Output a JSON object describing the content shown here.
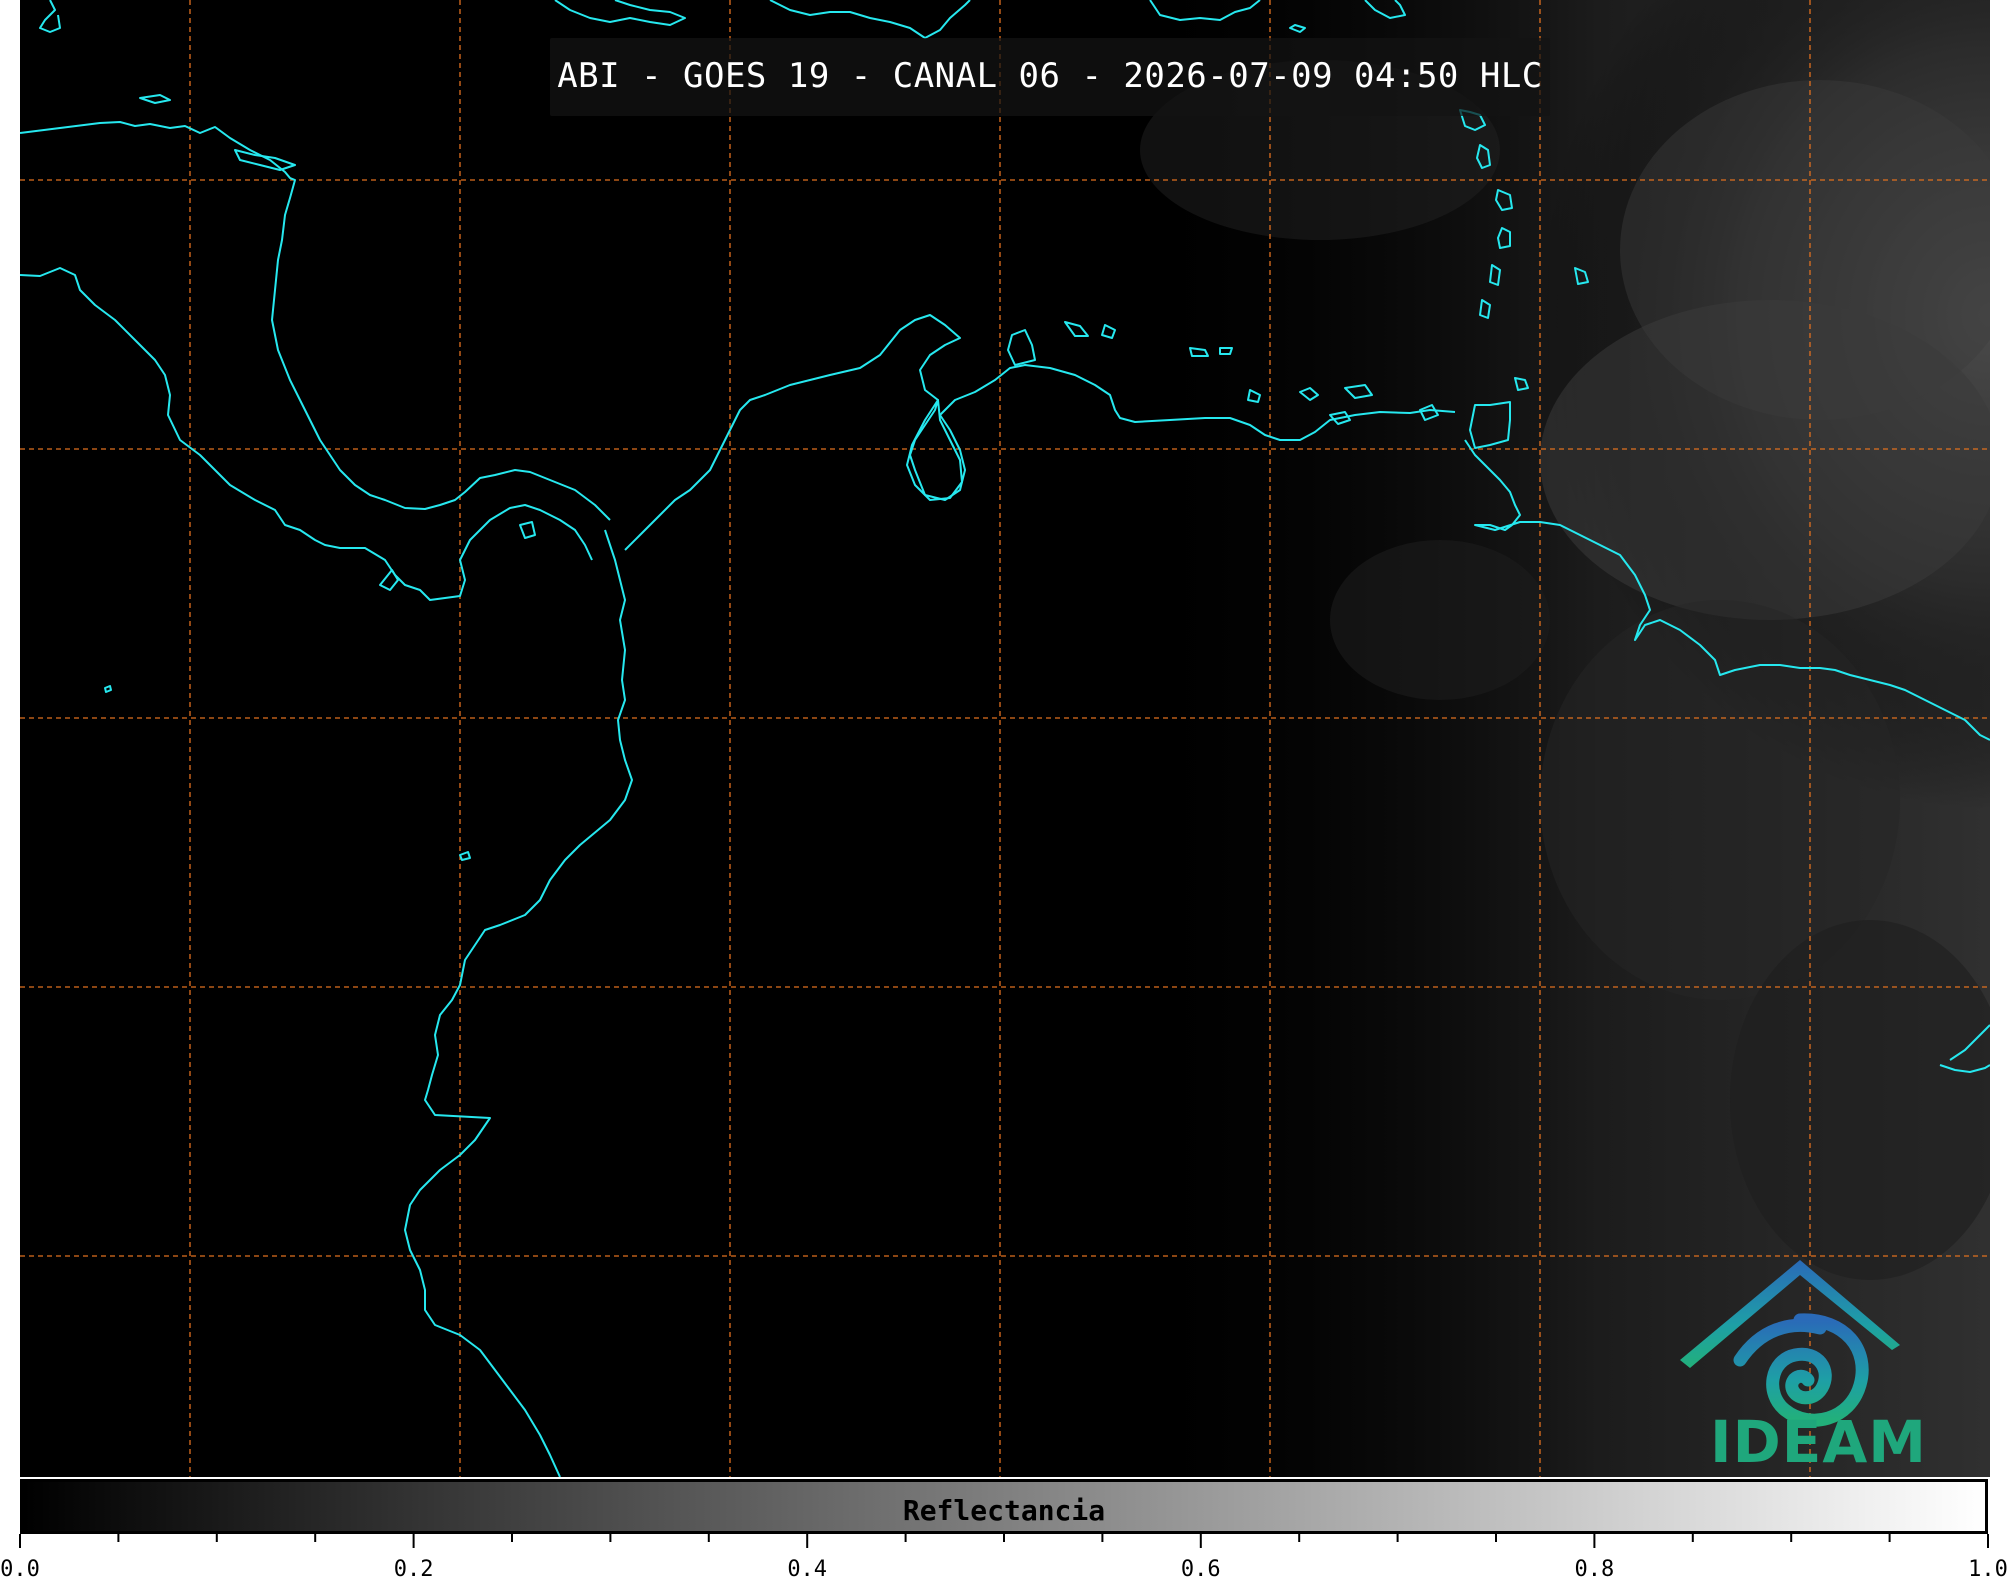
{
  "map": {
    "title": "ABI - GOES 19 - CANAL 06 - 2026-07-09 04:50 HLC",
    "coastline_color": "#26e8ef",
    "grid_color": "#e0701f",
    "background_color": "#000000",
    "logo_text": "IDEAM"
  },
  "colorbar": {
    "label": "Reflectancia",
    "ticks": [
      "0.0",
      "0.2",
      "0.4",
      "0.6",
      "0.8",
      "1.0"
    ],
    "range": [
      0.0,
      1.0
    ],
    "colormap": "gray"
  }
}
